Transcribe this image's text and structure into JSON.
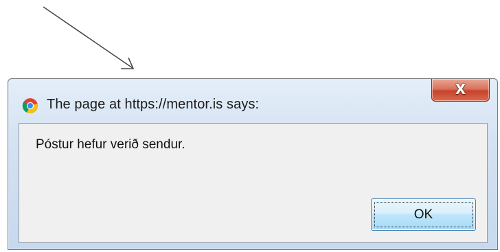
{
  "dialog": {
    "title": "The page at https://mentor.is says:",
    "close_label": "X",
    "message": "Póstur hefur verið sendur.",
    "ok_label": "OK",
    "icon": "chrome-icon"
  },
  "colors": {
    "annotation_arrow": "#4a4a4a",
    "close_button": "#c7432a",
    "ok_button": "#bee6fd",
    "content_background": "#f0f0f0"
  }
}
